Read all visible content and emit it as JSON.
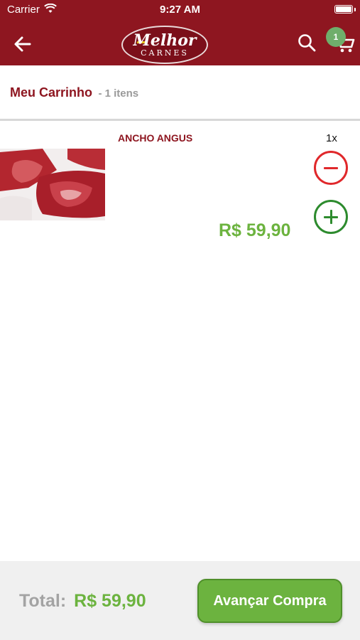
{
  "status_bar": {
    "carrier": "Carrier",
    "time": "9:27 AM"
  },
  "header": {
    "logo_line1": "Melhor",
    "logo_line2": "CARNES",
    "cart_badge_count": "1",
    "brand_color": "#8e1620"
  },
  "cart_summary": {
    "title": "Meu Carrinho",
    "count_text": "- 1 itens"
  },
  "items": [
    {
      "name": "ANCHO ANGUS",
      "quantity": "1x",
      "price": "R$ 59,90",
      "image_icon": "steak-photo"
    }
  ],
  "footer": {
    "total_label": "Total:",
    "total_value": "R$ 59,90",
    "checkout_label": "Avançar Compra"
  },
  "colors": {
    "accent_green": "#6cb33f",
    "minus_red": "#e0282b",
    "plus_green": "#2d8b2e"
  }
}
